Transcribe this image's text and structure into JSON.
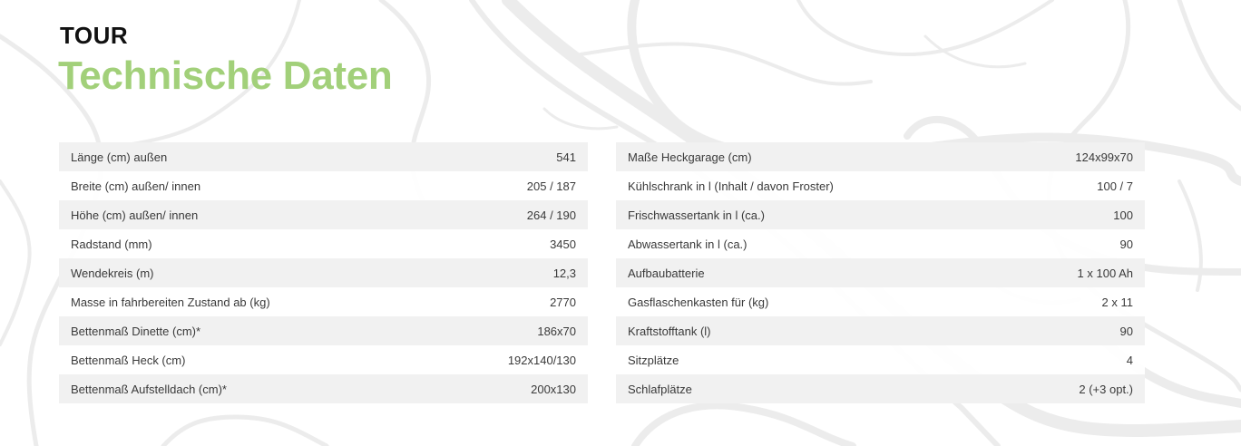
{
  "header": {
    "eyebrow": "TOUR",
    "title": "Technische Daten"
  },
  "colors": {
    "title_green": "#a2d07a",
    "row_stripe": "#f1f1f1",
    "map_lines": "#e9e9e9"
  },
  "specs_left": [
    {
      "label": "Länge (cm) außen",
      "value": "541"
    },
    {
      "label": "Breite (cm) außen/ innen",
      "value": "205 / 187"
    },
    {
      "label": "Höhe (cm) außen/ innen",
      "value": "264 / 190"
    },
    {
      "label": "Radstand (mm)",
      "value": "3450"
    },
    {
      "label": "Wendekreis (m)",
      "value": "12,3"
    },
    {
      "label": "Masse in fahrbereiten Zustand ab (kg)",
      "value": "2770"
    },
    {
      "label": "Bettenmaß Dinette (cm)*",
      "value": "186x70"
    },
    {
      "label": "Bettenmaß Heck (cm)",
      "value": "192x140/130"
    },
    {
      "label": "Bettenmaß Aufstelldach (cm)*",
      "value": "200x130"
    }
  ],
  "specs_right": [
    {
      "label": "Maße Heckgarage (cm)",
      "value": "124x99x70"
    },
    {
      "label": "Kühlschrank in l (Inhalt / davon Froster)",
      "value": "100 / 7"
    },
    {
      "label": "Frischwassertank in l (ca.)",
      "value": "100"
    },
    {
      "label": "Abwassertank in l (ca.)",
      "value": "90"
    },
    {
      "label": "Aufbaubatterie",
      "value": "1 x 100 Ah"
    },
    {
      "label": "Gasflaschenkasten für (kg)",
      "value": "2 x 11"
    },
    {
      "label": "Kraftstofftank (l)",
      "value": "90"
    },
    {
      "label": "Sitzplätze",
      "value": "4"
    },
    {
      "label": "Schlafplätze",
      "value": "2 (+3 opt.)"
    }
  ]
}
